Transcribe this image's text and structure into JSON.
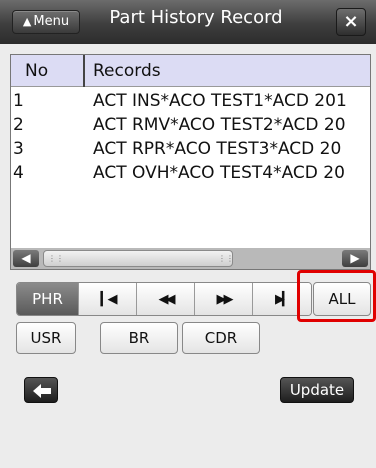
{
  "header": {
    "menu_label": "Menu",
    "title": "Part History Record",
    "close_label": "×"
  },
  "list": {
    "columns": [
      "No",
      "Records"
    ],
    "rows": [
      {
        "no": "1",
        "record": "ACT INS*ACO TEST1*ACD 201"
      },
      {
        "no": "2",
        "record": "ACT RMV*ACO TEST2*ACD 20"
      },
      {
        "no": "3",
        "record": "ACT RPR*ACO TEST3*ACD 20"
      },
      {
        "no": "4",
        "record": "ACT OVH*ACO TEST4*ACD 20"
      }
    ]
  },
  "nav": {
    "phr_label": "PHR",
    "first_icon": "skip-first-icon",
    "prev_icon": "rewind-icon",
    "next_icon": "fast-forward-icon",
    "last_icon": "skip-last-icon",
    "all_label": "ALL"
  },
  "buttons": {
    "usr_label": "USR",
    "br_label": "BR",
    "cdr_label": "CDR",
    "update_label": "Update",
    "back_icon": "back-arrow-icon"
  },
  "colors": {
    "header_row_bg": "#dcdcf4",
    "highlight": "#e00000",
    "active_segment": "#6e6e6e"
  }
}
